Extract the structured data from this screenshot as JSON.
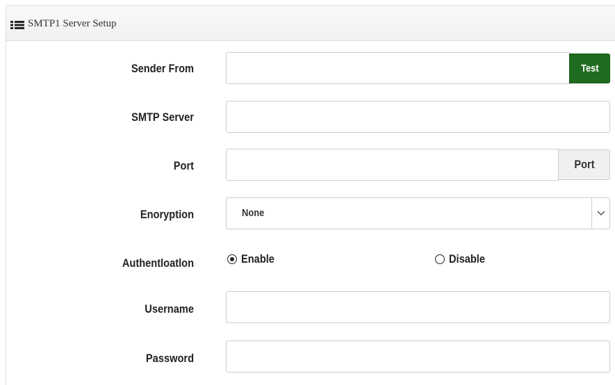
{
  "panel": {
    "title": "SMTP1 Server Setup",
    "icon": "list-icon"
  },
  "fields": {
    "sender_from": {
      "label": "Sender From",
      "value": "",
      "button": "Test",
      "button_color": "#1f6b1f"
    },
    "smtp_server": {
      "label": "SMTP Server",
      "value": ""
    },
    "port": {
      "label": "Port",
      "value": "",
      "addon": "Port"
    },
    "encryption": {
      "label": "Enoryption",
      "selected": "None"
    },
    "authentication": {
      "label": "Authentloatlon",
      "options": [
        "Enable",
        "Disable"
      ],
      "selected": "Enable"
    },
    "username": {
      "label": "Username",
      "value": ""
    },
    "password": {
      "label": "Password",
      "value": ""
    }
  }
}
